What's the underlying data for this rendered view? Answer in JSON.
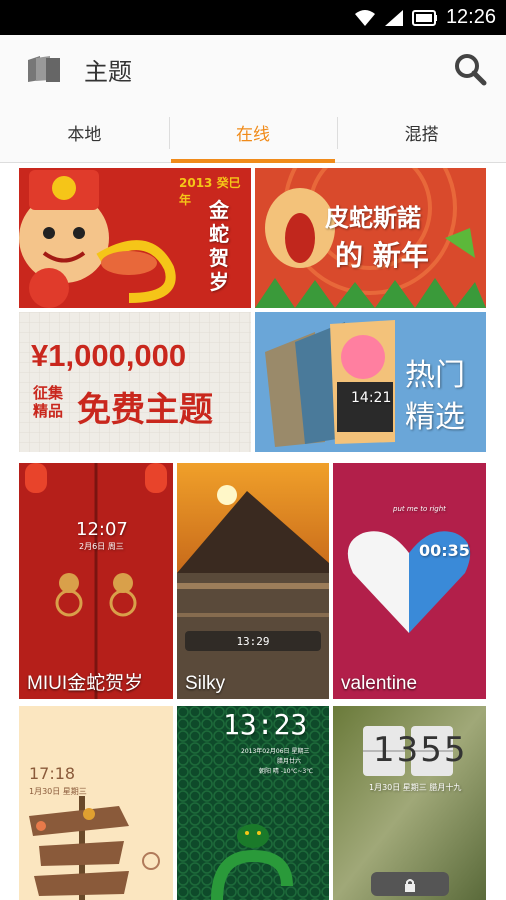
{
  "status_bar": {
    "time": "12:26"
  },
  "app_bar": {
    "title": "主题"
  },
  "tabs": [
    {
      "label": "本地",
      "active": false
    },
    {
      "label": "在线",
      "active": true
    },
    {
      "label": "混搭",
      "active": false
    }
  ],
  "banners": {
    "snake_new_year": {
      "year_tag": "2013 癸巳年",
      "calligraphy": "金蛇贺岁"
    },
    "snake_party": {
      "line1": "皮蛇斯諾",
      "line2": "的 新年"
    },
    "million": {
      "amount": "¥1,000,000",
      "small": "征集精品",
      "big": "免费主题"
    },
    "hot": {
      "line1": "热门",
      "line2": "精选",
      "clock": "14:21"
    }
  },
  "themes": [
    {
      "label": "MIUI金蛇贺岁",
      "clock": "12:07",
      "date": "2月6日 周三"
    },
    {
      "label": "Silky",
      "clock": "13:29"
    },
    {
      "label": "valentine",
      "clock": "00:35",
      "caption": "put me to right"
    },
    {
      "clock": "17:18",
      "date": "1月30日 星期三"
    },
    {
      "clock": "13:23",
      "date": "2013年02月06日 星期三",
      "sub": "腊月廿六",
      "weather": "朝阳 晴 -10℃~3℃"
    },
    {
      "clock": "1355",
      "date": "1月30日 星期三 腊月十九"
    }
  ],
  "colors": {
    "accent": "#f08b1a"
  }
}
